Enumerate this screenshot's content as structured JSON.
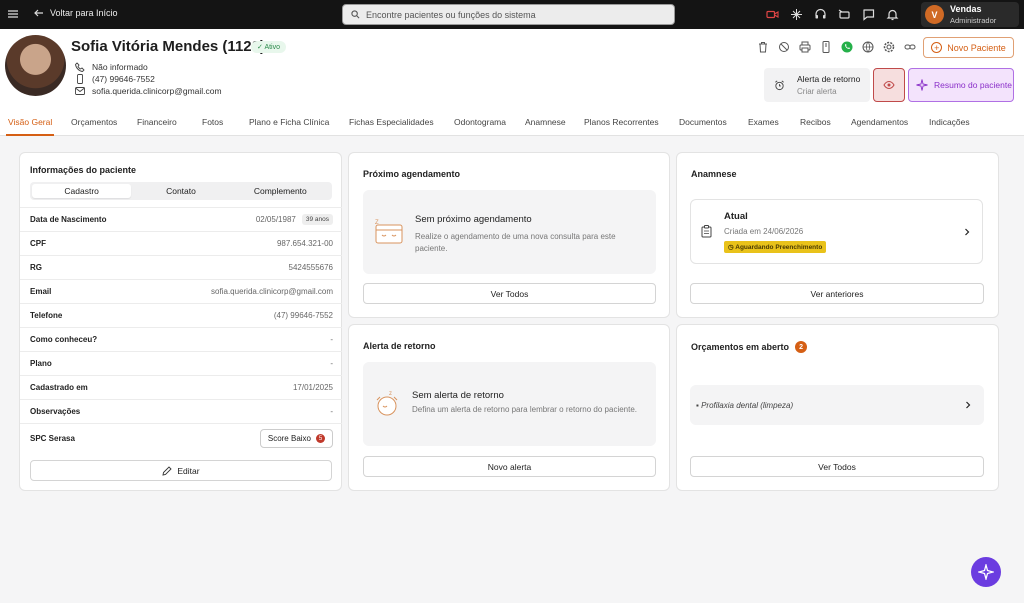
{
  "topbar": {
    "back_label": "Voltar para Início",
    "search_placeholder": "Encontre pacientes ou funções do sistema",
    "user": {
      "initial": "V",
      "name": "Vendas",
      "role": "Administrador"
    }
  },
  "patient": {
    "name": "Sofia Vitória Mendes (1120)",
    "status": "Ativo",
    "phone_landline": "Não informado",
    "phone_mobile": "(47) 99646-7552",
    "email": "sofia.querida.clinicorp@gmail.com"
  },
  "header_actions": {
    "new_patient": "Novo Paciente",
    "alert_title": "Alerta de retorno",
    "alert_sub": "Criar alerta",
    "summary": "Resumo do paciente"
  },
  "tabs": [
    "Visão Geral",
    "Orçamentos",
    "Financeiro",
    "Fotos",
    "Plano e Ficha Clínica",
    "Fichas Especialidades",
    "Odontograma",
    "Anamnese",
    "Planos Recorrentes",
    "Documentos",
    "Exames",
    "Recibos",
    "Agendamentos",
    "Indicações"
  ],
  "info_card": {
    "title": "Informações do paciente",
    "segments": [
      "Cadastro",
      "Contato",
      "Complemento"
    ],
    "rows": [
      {
        "label": "Data de Nascimento",
        "value": "02/05/1987",
        "extra": "39 anos"
      },
      {
        "label": "CPF",
        "value": "987.654.321-00"
      },
      {
        "label": "RG",
        "value": "5424555676"
      },
      {
        "label": "Email",
        "value": "sofia.querida.clinicorp@gmail.com"
      },
      {
        "label": "Telefone",
        "value": "(47) 99646-7552"
      },
      {
        "label": "Como conheceu?",
        "value": "-"
      },
      {
        "label": "Plano",
        "value": "-"
      },
      {
        "label": "Cadastrado em",
        "value": "17/01/2025"
      },
      {
        "label": "Observações",
        "value": "-"
      }
    ],
    "spc_label": "SPC Serasa",
    "score_label": "Score Baixo",
    "score_value": "5",
    "edit_label": "Editar"
  },
  "next_appointment": {
    "title": "Próximo agendamento",
    "empty_title": "Sem próximo agendamento",
    "empty_sub": "Realize o agendamento de uma nova consulta para este paciente.",
    "button": "Ver Todos"
  },
  "anamnese": {
    "title": "Anamnese",
    "item_title": "Atual",
    "item_date": "Criada em 24/06/2026",
    "item_status": "Aguardando Preenchimento",
    "button": "Ver anteriores"
  },
  "return_alert": {
    "title": "Alerta de retorno",
    "empty_title": "Sem alerta de retorno",
    "empty_sub": "Defina um alerta de retorno para lembrar o retorno do paciente.",
    "button": "Novo alerta"
  },
  "budgets": {
    "title": "Orçamentos em aberto",
    "count": "2",
    "item": "Profilaxia dental (limpeza)",
    "button": "Ver Todos"
  },
  "colors": {
    "accent": "#d55f14",
    "purple": "#6b3ce0",
    "topbar": "#141414"
  }
}
